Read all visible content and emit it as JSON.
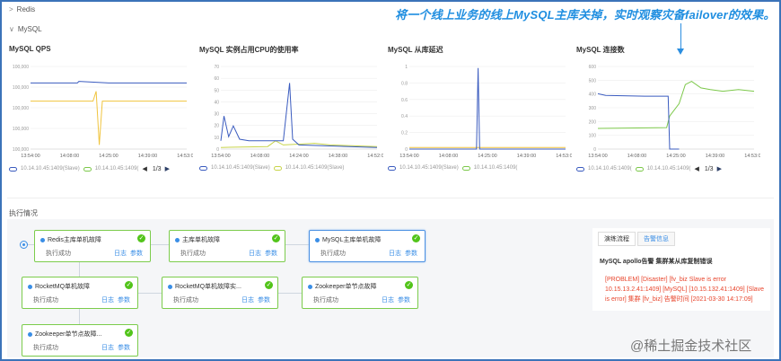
{
  "sections": {
    "redis": "Redis",
    "mysql": "MySQL"
  },
  "annotation": "将一个线上业务的线上MySQL主库关掉，实时观察灾备failover的效果。",
  "charts": [
    {
      "title": "MySQL QPS",
      "yticks": [
        "100,000",
        "100,000",
        "100,000",
        "100,000",
        "100,000"
      ],
      "xticks": [
        "13:54:00",
        "14:08:00",
        "14:25:00",
        "14:39:00",
        "14:53:00"
      ],
      "legend": [
        "10.14.10.45:1409(Slave)",
        "10.14.10.45:1409("
      ],
      "pager": "1/3"
    },
    {
      "title": "MySQL 实例占用CPU的使用率",
      "yticks": [
        "70",
        "60",
        "50",
        "40",
        "30",
        "20",
        "10",
        "0"
      ],
      "xticks": [
        "13:54:00",
        "14:08:00",
        "14:24:00",
        "14:38:00",
        "14:52:00"
      ],
      "legend": [
        "10.14.10.45:1409(Slave)",
        "10.14.10.45:1409(Slave)"
      ],
      "pager": "1/3"
    },
    {
      "title": "MySQL 从库延迟",
      "yticks": [
        "1",
        "0.8",
        "0.6",
        "0.4",
        "0.2",
        "0"
      ],
      "xticks": [
        "13:54:00",
        "14:08:00",
        "14:25:00",
        "14:39:00",
        "14:53:00"
      ],
      "legend": [
        "10.14.10.45:1409(Slave)",
        "10.14.10.45:1409("
      ],
      "pager": "1/3"
    },
    {
      "title": "MySQL 连接数",
      "yticks": [
        "600",
        "500",
        "400",
        "300",
        "200",
        "100",
        "0"
      ],
      "xticks": [
        "13:54:00",
        "14:08:00",
        "14:25:00",
        "14:39:00",
        "14:53:00"
      ],
      "legend": [
        "10.14.10.45:1409(",
        "10.14.10.45:1409("
      ],
      "pager": "1/3"
    }
  ],
  "chart_data": [
    {
      "type": "line",
      "title": "MySQL QPS",
      "x": [
        "13:54:00",
        "14:08:00",
        "14:25:00",
        "14:39:00",
        "14:53:00"
      ],
      "series": [
        {
          "color": "#f0c43f"
        },
        {
          "color": "#3a5bbf"
        }
      ]
    },
    {
      "type": "line",
      "title": "MySQL 实例占用CPU的使用率",
      "x": [
        "13:54:00",
        "14:08:00",
        "14:24:00",
        "14:38:00",
        "14:52:00"
      ],
      "ylim": [
        0,
        70
      ],
      "series": [
        {
          "color": "#3a5bbf"
        },
        {
          "color": "#c8d44a"
        }
      ]
    },
    {
      "type": "line",
      "title": "MySQL 从库延迟",
      "x": [
        "13:54:00",
        "14:08:00",
        "14:25:00",
        "14:39:00",
        "14:53:00"
      ],
      "ylim": [
        0,
        1
      ],
      "series": [
        {
          "color": "#3a5bbf"
        },
        {
          "color": "#f0c43f"
        }
      ]
    },
    {
      "type": "line",
      "title": "MySQL 连接数",
      "x": [
        "13:54:00",
        "14:08:00",
        "14:25:00",
        "14:39:00",
        "14:53:00"
      ],
      "ylim": [
        0,
        600
      ],
      "series": [
        {
          "color": "#3a5bbf"
        },
        {
          "color": "#7cc84a"
        }
      ]
    }
  ],
  "exec": {
    "title": "执行情况"
  },
  "nodes": [
    {
      "name": "Redis主库单机故障",
      "status": "执行成功",
      "log": "日志",
      "param": "参数"
    },
    {
      "name": "主库单机故障",
      "status": "执行成功",
      "log": "日志",
      "param": "参数"
    },
    {
      "name": "MySQL主库单机故障",
      "status": "执行成功",
      "log": "日志",
      "param": "参数"
    },
    {
      "name": "RocketMQ单机故障",
      "status": "执行成功",
      "log": "日志",
      "param": "参数"
    },
    {
      "name": "RocketMQ单机故障实...",
      "status": "执行成功",
      "log": "日志",
      "param": "参数"
    },
    {
      "name": "Zookeeper单节点故障",
      "status": "执行成功",
      "log": "日志",
      "param": "参数"
    },
    {
      "name": "Zookeeper单节点故障...",
      "status": "执行成功",
      "log": "日志",
      "param": "参数"
    }
  ],
  "panel": {
    "tab1": "演练流程",
    "tab2": "告警信息",
    "alert_title": "MySQL apollo告警 集群某从库复制错误",
    "alert_body": "[PROBLEM] [Disaster] [fv_biz Slave is error 10.15.13.2.41:1409] [MySQL] [10.15.132.41:1409] [Slave is error] 集群 [fv_biz] 告警时间 [2021-03-30 14:17:09]"
  },
  "watermark": "@稀土掘金技术社区"
}
